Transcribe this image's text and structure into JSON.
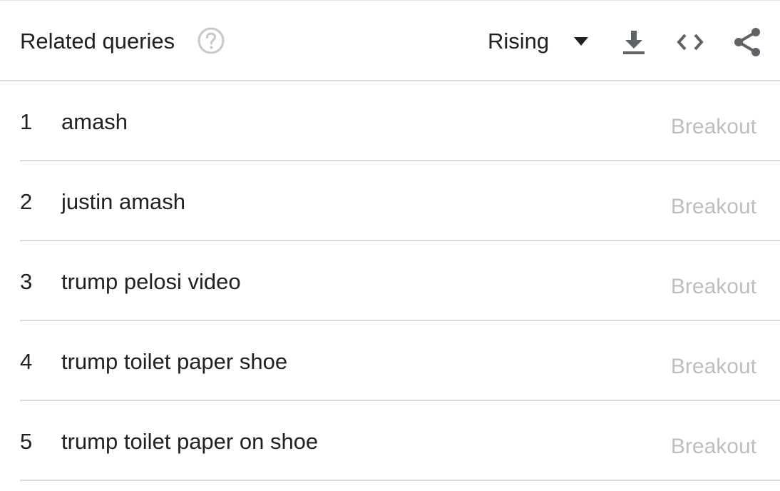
{
  "header": {
    "title": "Related queries",
    "help_icon": "help-circle-icon",
    "filter": {
      "selected": "Rising",
      "caret_icon": "caret-down-icon"
    },
    "actions": {
      "download_icon": "download-icon",
      "embed_icon": "code-embed-icon",
      "share_icon": "share-icon"
    }
  },
  "queries": [
    {
      "rank": "1",
      "query": "amash",
      "value": "Breakout"
    },
    {
      "rank": "2",
      "query": "justin amash",
      "value": "Breakout"
    },
    {
      "rank": "3",
      "query": "trump pelosi video",
      "value": "Breakout"
    },
    {
      "rank": "4",
      "query": "trump toilet paper shoe",
      "value": "Breakout"
    },
    {
      "rank": "5",
      "query": "trump toilet paper on shoe",
      "value": "Breakout"
    }
  ],
  "colors": {
    "text": "#202124",
    "muted": "#bdbdbd",
    "icon": "#5f6368",
    "divider": "#dadada"
  }
}
